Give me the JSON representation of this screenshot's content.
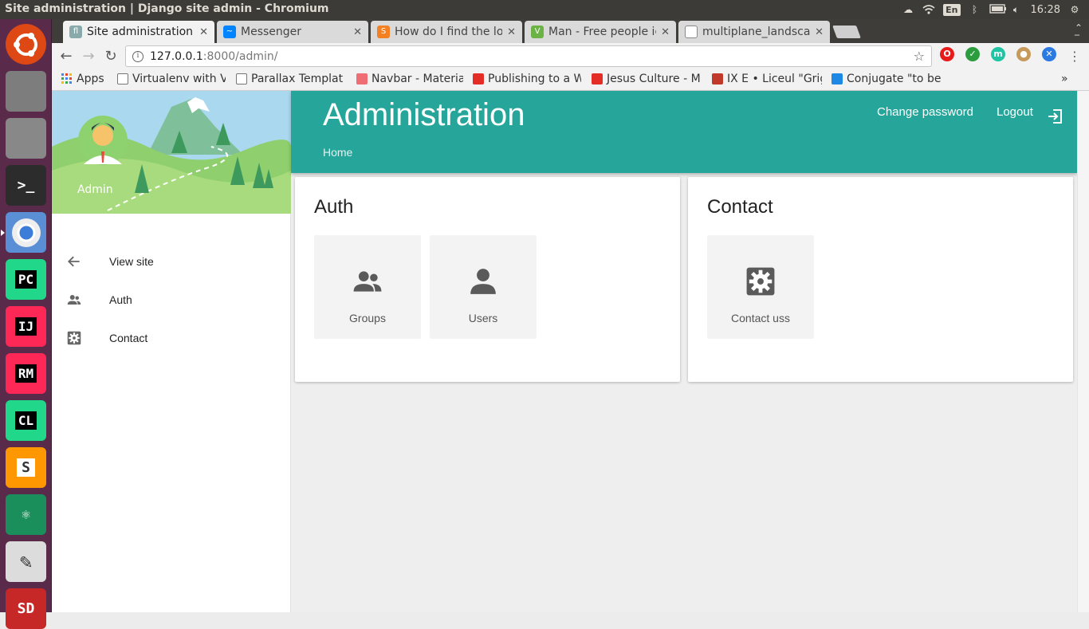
{
  "os": {
    "window_title": "Site administration | Django site admin - Chromium",
    "tray": {
      "lang": "En",
      "clock": "16:28"
    },
    "launcher": [
      {
        "name": "ubuntu-logo-icon",
        "label": "",
        "color": "#dd4814"
      },
      {
        "name": "file-cabinet-icon",
        "label": "",
        "color": "#7d7d7d"
      },
      {
        "name": "settings-tools-icon",
        "label": "",
        "color": "#888"
      },
      {
        "name": "terminal-icon",
        "label": ">_",
        "color": "#2c2c2c"
      },
      {
        "name": "chromium-icon",
        "label": "",
        "color": "#3b7dd8"
      },
      {
        "name": "pycharm-icon",
        "label": "PC",
        "color": "#21d789"
      },
      {
        "name": "intellij-icon",
        "label": "IJ",
        "color": "#fe2857"
      },
      {
        "name": "rubymine-icon",
        "label": "RM",
        "color": "#fe2857"
      },
      {
        "name": "clion-icon",
        "label": "CL",
        "color": "#21d789"
      },
      {
        "name": "sublime-icon",
        "label": "S",
        "color": "#ff9800"
      },
      {
        "name": "atom-icon",
        "label": "⚛",
        "color": "#1a8f5c"
      },
      {
        "name": "text-editor-icon",
        "label": "✎",
        "color": "#dcdcdc"
      },
      {
        "name": "sd-card-icon",
        "label": "SD",
        "color": "#c62828"
      }
    ]
  },
  "browser": {
    "tabs": [
      {
        "label": "Site administration",
        "favicon": "fl",
        "color": "#8aa"
      },
      {
        "label": "Messenger",
        "favicon": "~",
        "color": "#0084ff"
      },
      {
        "label": "How do I find the lo",
        "favicon": "S",
        "color": "#f48024"
      },
      {
        "label": "Man - Free people ic",
        "favicon": "V",
        "color": "#6bb344"
      },
      {
        "label": "multiplane_landsca",
        "favicon": "",
        "color": "#ffffff"
      }
    ],
    "url_host": "127.0.0.1",
    "url_path": ":8000/admin/",
    "extensions": [
      {
        "name": "opera-icon",
        "label": "O",
        "color": "#e81b1b"
      },
      {
        "name": "check-icon",
        "label": "✓",
        "color": "#2c9d3f"
      },
      {
        "name": "m-icon",
        "label": "m",
        "color": "#1ec4a4"
      },
      {
        "name": "cookie-icon",
        "label": "●",
        "color": "#c69a5a"
      },
      {
        "name": "cross-icon",
        "label": "✕",
        "color": "#2a7ae4"
      }
    ],
    "bookmarks": [
      {
        "label": "Apps",
        "icon": "apps-grid-icon",
        "color": "#444"
      },
      {
        "label": "Virtualenv with V",
        "icon": "page-icon",
        "color": "#888"
      },
      {
        "label": "Parallax Templat",
        "icon": "page-icon",
        "color": "#888"
      },
      {
        "label": "Navbar - Materia",
        "icon": "materialize-icon",
        "color": "#ee6e73"
      },
      {
        "label": "Publishing to a W",
        "icon": "youtube-icon",
        "color": "#e52d27"
      },
      {
        "label": "Jesus Culture - M",
        "icon": "youtube-icon",
        "color": "#e52d27"
      },
      {
        "label": "IX E • Liceul \"Grig",
        "icon": "shield-icon",
        "color": "#c0392b"
      },
      {
        "label": "Conjugate \"to be",
        "icon": "bubble-icon",
        "color": "#1e88e5"
      }
    ],
    "more_bookmarks": "»"
  },
  "admin": {
    "user_name": "Admin",
    "title": "Administration",
    "breadcrumb": "Home",
    "change_password": "Change password",
    "logout": "Logout",
    "menu": [
      {
        "label": "View site",
        "icon": "arrow-left-icon"
      },
      {
        "label": "Auth",
        "icon": "people-icon"
      },
      {
        "label": "Contact",
        "icon": "gear-box-icon"
      }
    ],
    "apps": [
      {
        "title": "Auth",
        "models": [
          {
            "label": "Groups",
            "icon": "people-icon"
          },
          {
            "label": "Users",
            "icon": "person-icon"
          }
        ]
      },
      {
        "title": "Contact",
        "models": [
          {
            "label": "Contact uss",
            "icon": "gear-box-icon"
          }
        ]
      }
    ],
    "accent": "#26a69a"
  }
}
